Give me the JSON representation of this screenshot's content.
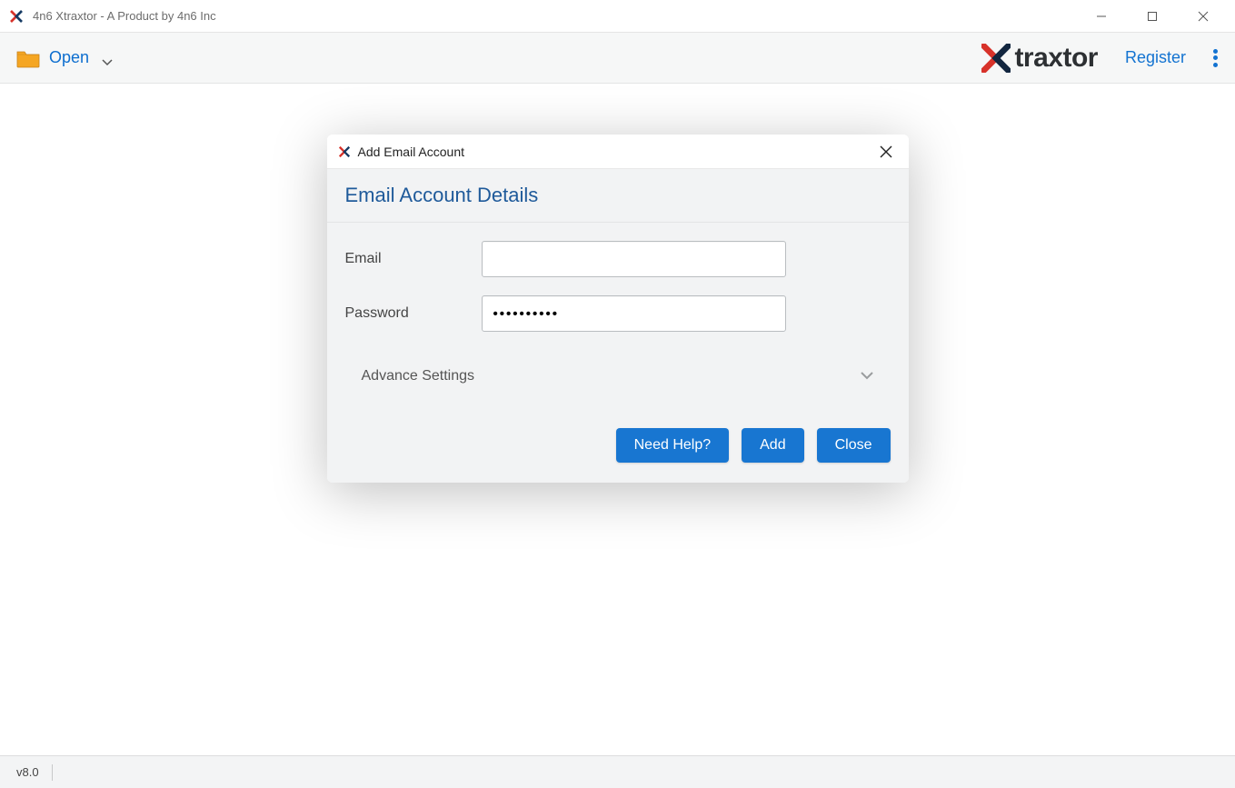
{
  "window": {
    "title": "4n6 Xtraxtor - A Product by 4n6 Inc"
  },
  "toolbar": {
    "open_label": "Open",
    "register_label": "Register",
    "logo_text": "traxtor"
  },
  "modal": {
    "title": "Add Email Account",
    "header": "Email Account Details",
    "fields": {
      "email_label": "Email",
      "email_value": "",
      "password_label": "Password",
      "password_value": "••••••••••"
    },
    "advance_label": "Advance Settings",
    "buttons": {
      "help": "Need Help?",
      "add": "Add",
      "close": "Close"
    }
  },
  "statusbar": {
    "version": "v8.0"
  }
}
